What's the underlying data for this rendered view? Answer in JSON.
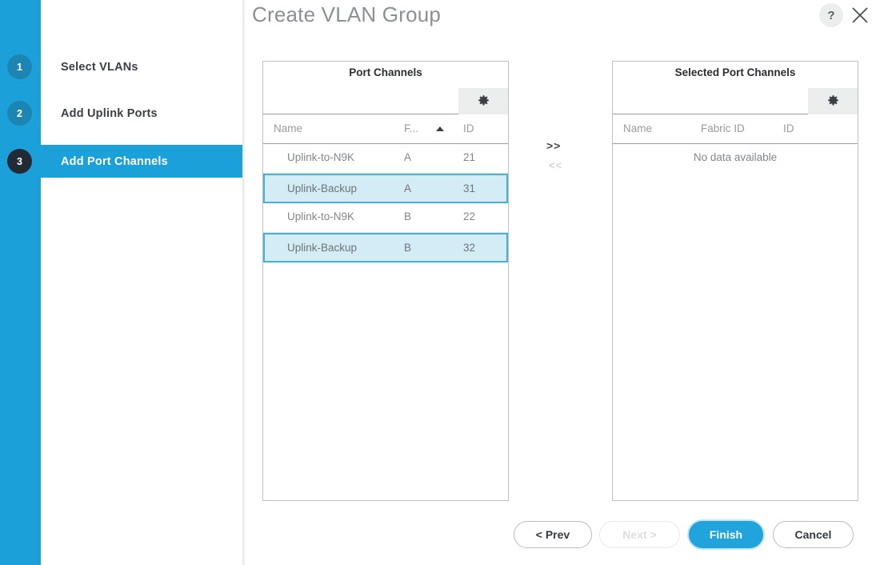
{
  "header": {
    "title": "Create VLAN Group",
    "help_icon": "question-mark-icon",
    "help_label": "?",
    "close_icon": "close-icon"
  },
  "wizard": {
    "steps": [
      {
        "number": "1",
        "label": "Select VLANs",
        "active": false
      },
      {
        "number": "2",
        "label": "Add Uplink Ports",
        "active": false
      },
      {
        "number": "3",
        "label": "Add Port Channels",
        "active": true
      }
    ]
  },
  "available_panel": {
    "title": "Port Channels",
    "gear_icon": "gear-icon",
    "columns": [
      "Name",
      "F...",
      "ID"
    ],
    "sort_column": "F...",
    "sort_direction": "ascending",
    "rows": [
      {
        "name": "Uplink-to-N9K",
        "fabric": "A",
        "id": "21",
        "selected": false
      },
      {
        "name": "Uplink-Backup",
        "fabric": "A",
        "id": "31",
        "selected": true
      },
      {
        "name": "Uplink-to-N9K",
        "fabric": "B",
        "id": "22",
        "selected": false
      },
      {
        "name": "Uplink-Backup",
        "fabric": "B",
        "id": "32",
        "selected": true
      }
    ]
  },
  "selected_panel": {
    "title": "Selected Port Channels",
    "gear_icon": "gear-icon",
    "columns": [
      "Name",
      "Fabric ID",
      "ID"
    ],
    "empty_message": "No data available",
    "rows": []
  },
  "transfer": {
    "add_label": ">>",
    "remove_label": "<<"
  },
  "footer": {
    "prev_label": "< Prev",
    "next_label": "Next >",
    "finish_label": "Finish",
    "cancel_label": "Cancel"
  },
  "colors": {
    "accent_blue": "#1ba0da",
    "primary_button": "#21a3db",
    "selected_row_fill": "#d4ecf6",
    "selected_row_border": "#47b0d8",
    "active_step_circle": "#222a35",
    "inactive_step_circle": "#1c85b2"
  }
}
